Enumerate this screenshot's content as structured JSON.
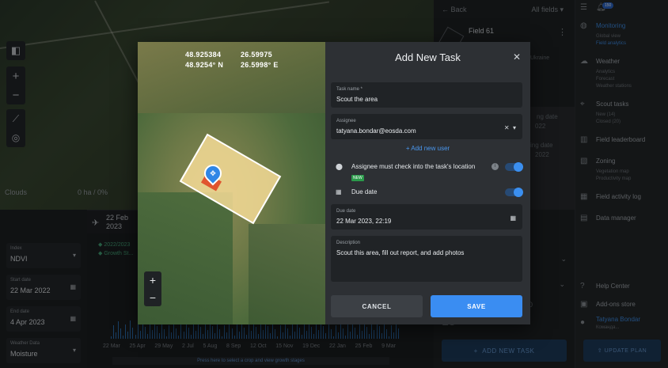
{
  "map": {
    "clouds_label": "Clouds",
    "clouds_value": "0 ha / 0%"
  },
  "analytics": {
    "date": "22 Feb\n2023",
    "legend": [
      "2022/2023",
      "Growth St..."
    ],
    "fields": [
      {
        "label": "Index",
        "value": "NDVI"
      },
      {
        "label": "Start date",
        "value": "22 Mar 2022"
      },
      {
        "label": "End date",
        "value": "4 Apr 2023"
      },
      {
        "label": "Weather Data",
        "value": "Moisture"
      }
    ],
    "x_ticks": [
      "22 Mar",
      "25 Apr",
      "29 May",
      "2 Jul",
      "5 Aug",
      "8 Sep",
      "12 Oct",
      "15 Nov",
      "19 Dec",
      "22 Jan",
      "25 Feb",
      "9 Mar"
    ],
    "hint": "Press here to select a crop and view growth stages"
  },
  "field_panel": {
    "back": "Back",
    "all_fields": "All fields",
    "field_name": "Field 61",
    "region": "Ukraine",
    "gray_text": [
      "ng date",
      "022",
      "ing date",
      "2022"
    ],
    "number": "15",
    "zero": "0",
    "add_task": "ADD NEW TASK"
  },
  "nav": {
    "badge": "150",
    "items": [
      {
        "label": "Monitoring",
        "active": true,
        "icon": "globe-icon",
        "subs": [
          "Global view",
          "Field analytics"
        ]
      },
      {
        "label": "Weather",
        "active": false,
        "icon": "cloud-icon",
        "subs": [
          "Analytics",
          "Forecast",
          "Weather stations"
        ]
      },
      {
        "label": "Scout tasks",
        "active": false,
        "icon": "pin-icon",
        "subs": [
          "New (14)",
          "Closed (20)"
        ]
      },
      {
        "label": "Field leaderboard",
        "active": false,
        "icon": "chart-icon",
        "subs": []
      },
      {
        "label": "Zoning",
        "active": false,
        "icon": "zoning-icon",
        "subs": [
          "Vegetation map",
          "Productivity map"
        ]
      },
      {
        "label": "Field activity log",
        "active": false,
        "icon": "calendar-icon",
        "subs": []
      },
      {
        "label": "Data manager",
        "active": false,
        "icon": "data-icon",
        "subs": []
      }
    ],
    "help": "Help Center",
    "addon": "Add-ons store",
    "user": "Tatyana Bondar",
    "team": "Команда...",
    "upgrade": "UPDATE PLAN"
  },
  "modal": {
    "title": "Add New Task",
    "coords": {
      "lat": "48.925384",
      "lon": "26.59975",
      "lat_deg": "48.9254° N",
      "lon_deg": "26.5998° E"
    },
    "task_name": {
      "label": "Task name *",
      "value": "Scout the area"
    },
    "assignee": {
      "label": "Assignee",
      "value": "tatyana.bondar@eosda.com"
    },
    "add_user": "+ Add new user",
    "checkin": {
      "label": "Assignee must check into the task's location",
      "tag": "NEW",
      "on": true
    },
    "due": {
      "label": "Due date",
      "on": true
    },
    "due_date": {
      "label": "Due date",
      "value": "22 Mar 2023, 22:19"
    },
    "description": {
      "label": "Description",
      "value": "Scout this area, fill out report, and add photos"
    },
    "cancel": "CANCEL",
    "save": "SAVE"
  }
}
